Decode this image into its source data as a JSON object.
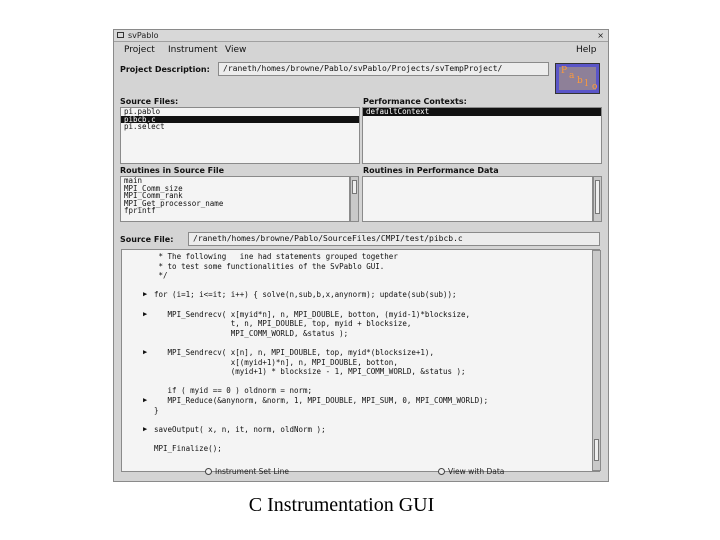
{
  "window": {
    "title": "svPablo"
  },
  "menu": {
    "project": "Project",
    "instrument": "Instrument",
    "view": "View",
    "help": "Help"
  },
  "project": {
    "label": "Project Description:",
    "value": "/raneth/homes/browne/Pablo/svPablo/Projects/svTempProject/"
  },
  "logo": {
    "glyphs": [
      "P",
      "a",
      "b",
      "l",
      "o"
    ]
  },
  "source_files": {
    "label": "Source Files:",
    "items": [
      {
        "text": "pi.pablo",
        "selected": false
      },
      {
        "text": "pibcb.c",
        "selected": true
      },
      {
        "text": "pi.select",
        "selected": false
      }
    ]
  },
  "performance_contexts": {
    "label": "Performance Contexts:",
    "items": [
      {
        "text": "defaultContext",
        "selected": true
      }
    ]
  },
  "routines_in_source": {
    "label": "Routines in Source File",
    "items": [
      "main",
      "MPI_Comm_size",
      "MPI_Comm_rank",
      "MPI_Get_processor_name",
      "fprintf"
    ]
  },
  "routines_in_perf": {
    "label": "Routines in Performance Data"
  },
  "source_file": {
    "label": "Source File:",
    "value": "/raneth/homes/browne/Pablo/SourceFiles/CMPI/test/pibcb.c"
  },
  "code_lines": [
    " * The following   ine had statements grouped together",
    " * to test some functionalities of the SvPablo GUI.",
    " */",
    "",
    "for (i=1; i<=it; i++) { solve(n,sub,b,x,anynorm); update(sub(sub));",
    "",
    "   MPI_Sendrecv( x[myid*n], n, MPI_DOUBLE, botton, (myid-1)*blocksize,",
    "                 t, n, MPI_DOUBLE, top, myid + blocksize,",
    "                 MPI_COMM_WORLD, &status );",
    "",
    "   MPI_Sendrecv( x[n], n, MPI_DOUBLE, top, myid*(blocksize+1),",
    "                 x[(myid+1)*n], n, MPI_DOUBLE, botton,",
    "                 (myid+1) * blocksize - 1, MPI_COMM_WORLD, &status );",
    "",
    "   if ( myid == 0 ) oldnorm = norm;",
    "   MPI_Reduce(&anynorm, &norm, 1, MPI_DOUBLE, MPI_SUM, 0, MPI_COMM_WORLD);",
    "}",
    "",
    "saveOutput( x, n, it, norm, oldNorm );",
    "",
    "MPI_Finalize();"
  ],
  "code_arrows": [
    "▶",
    "▶",
    "▶",
    "▶",
    "▶"
  ],
  "bottom": {
    "instrument_option": "Instrument Set Line",
    "view_option": "View with Data"
  },
  "caption": "C Instrumentation GUI"
}
